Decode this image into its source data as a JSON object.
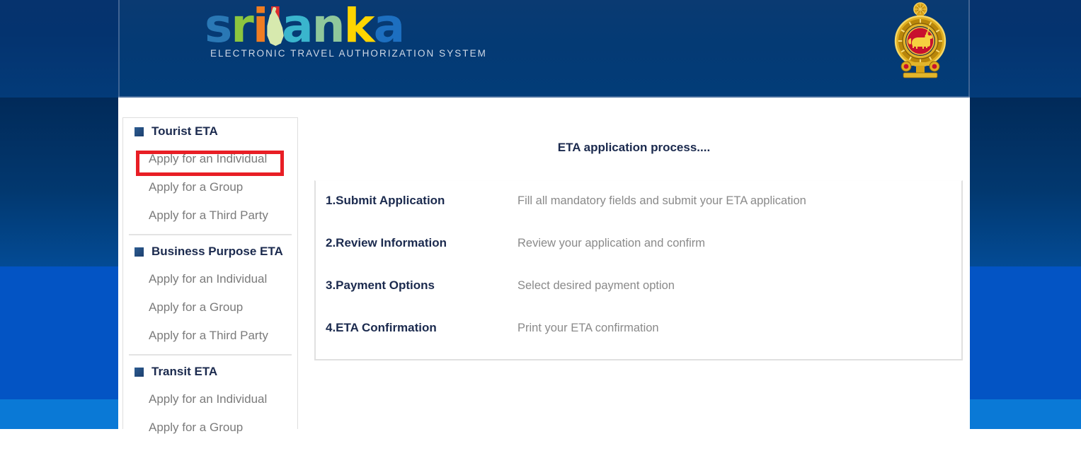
{
  "theme": {
    "header_blue": "#043a74",
    "band_bright_blue": "#0354c4",
    "band_light_blue": "#0a79d6",
    "heading_navy": "#1b2a4e",
    "menu_gray": "#7b7b7b",
    "highlight_red": "#e81e25",
    "panel_border_gray": "#e0e0e0"
  },
  "header": {
    "logo": {
      "letters": [
        {
          "char": "s",
          "color": "#2a78b5"
        },
        {
          "char": "r",
          "color": "#8cc63f"
        },
        {
          "char": "i",
          "color": "#f07d22"
        },
        {
          "char": "l",
          "color": "#e02b2b"
        },
        {
          "char": "a",
          "color": "#3ab5cd"
        },
        {
          "char": "n",
          "color": "#8fc79b"
        },
        {
          "char": "k",
          "color": "#ffd500"
        },
        {
          "char": "a",
          "color": "#1d6fc0"
        }
      ],
      "wordmark_text": "srilanka",
      "island_icon": "sri-lanka-island-shape",
      "tagline": "ELECTRONIC TRAVEL AUTHORIZATION SYSTEM"
    },
    "emblem": {
      "name": "sri-lanka-national-emblem",
      "alt": "National Emblem of Sri Lanka"
    }
  },
  "sidebar": {
    "groups": [
      {
        "title": "Tourist ETA",
        "items": [
          {
            "label": "Apply for an Individual",
            "highlighted": true
          },
          {
            "label": "Apply for a Group",
            "highlighted": false
          },
          {
            "label": "Apply for a Third Party",
            "highlighted": false
          }
        ]
      },
      {
        "title": "Business Purpose ETA",
        "items": [
          {
            "label": "Apply for an Individual",
            "highlighted": false
          },
          {
            "label": "Apply for a Group",
            "highlighted": false
          },
          {
            "label": "Apply for a Third Party",
            "highlighted": false
          }
        ]
      },
      {
        "title": "Transit ETA",
        "items": [
          {
            "label": "Apply for an Individual",
            "highlighted": false
          },
          {
            "label": "Apply for a Group",
            "highlighted": false
          }
        ]
      }
    ]
  },
  "main": {
    "title": "ETA application process....",
    "steps": [
      {
        "title": "1.Submit Application",
        "description": "Fill all mandatory fields and submit your ETA application"
      },
      {
        "title": "2.Review Information",
        "description": "Review your application and confirm"
      },
      {
        "title": "3.Payment Options",
        "description": "Select desired payment option"
      },
      {
        "title": "4.ETA Confirmation",
        "description": "Print your ETA confirmation"
      }
    ]
  }
}
